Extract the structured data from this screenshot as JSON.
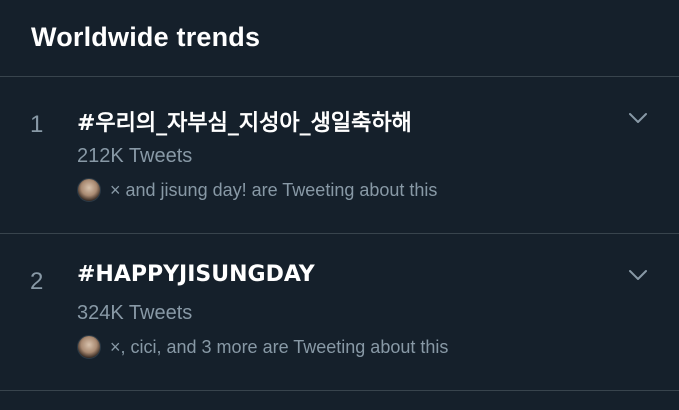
{
  "header": {
    "title": "Worldwide trends"
  },
  "trends": [
    {
      "rank": "1",
      "name": "#우리의_자부심_지성아_생일축하해",
      "count": "212K Tweets",
      "context": "× and jisung day! are Tweeting about this"
    },
    {
      "rank": "2",
      "name": "#HAPPYJISUNGDAY",
      "count": "324K Tweets",
      "context": "×, cici, and 3 more are Tweeting about this"
    }
  ],
  "icons": {
    "more": "chevron-down-icon",
    "avatar": "avatar"
  },
  "colors": {
    "background": "#15202b",
    "divider": "#38444d",
    "secondary_text": "#8899a6",
    "primary_text": "#ffffff"
  }
}
